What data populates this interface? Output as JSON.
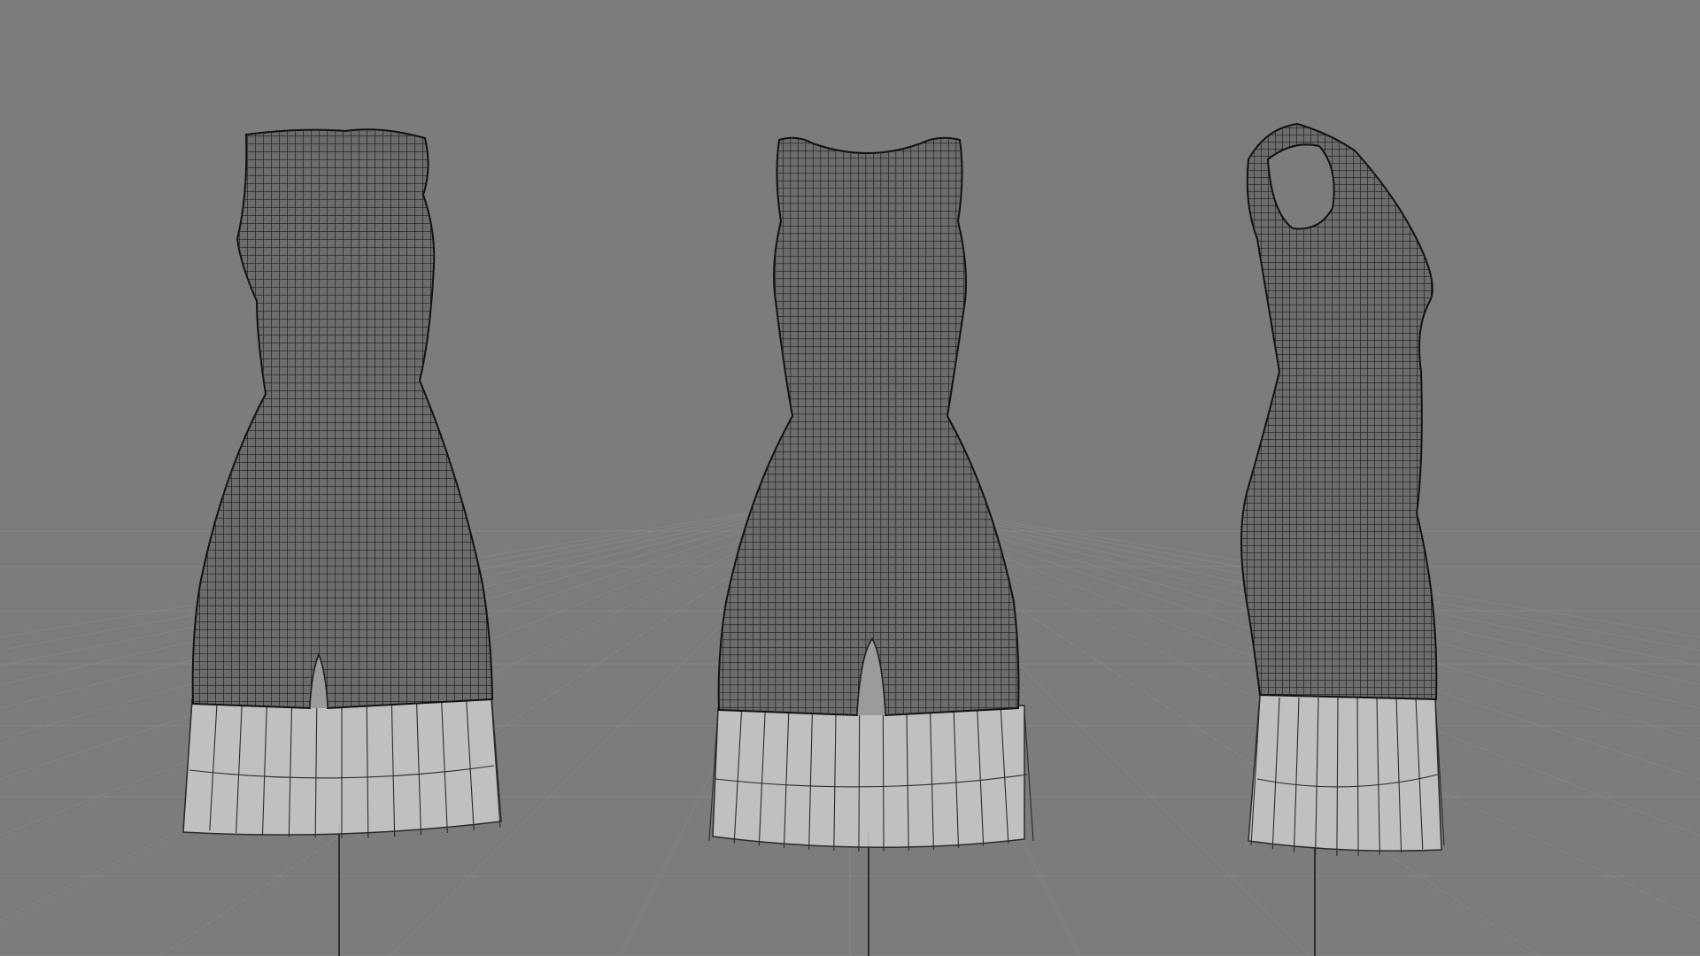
{
  "viewport": {
    "background_color": "#7b7c7d",
    "grid_color": "#858687",
    "wire_color": "#1c1c1c",
    "body_fill_color": "#6b6c6d",
    "skirt_fill_color": "#c9cacb",
    "skirt_line_color": "#2a2a2a",
    "pole_color": "#1a1a1a"
  },
  "models": [
    {
      "view": "back",
      "icon": "wireframe-garment-back-view"
    },
    {
      "view": "front",
      "icon": "wireframe-garment-front-view"
    },
    {
      "view": "side",
      "icon": "wireframe-garment-side-view"
    }
  ]
}
